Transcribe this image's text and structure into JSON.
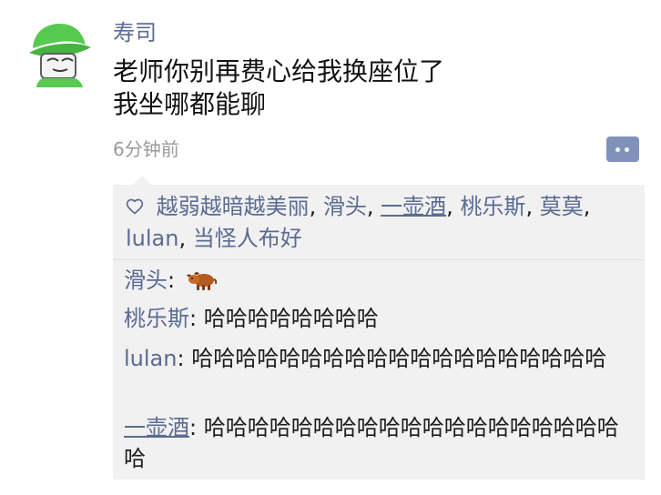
{
  "post": {
    "author": "寿司",
    "text": "老师你别再费心给我换座位了\n我坐哪都能聊",
    "time": "6分钟前"
  },
  "likes": {
    "names": [
      "越弱越暗越美丽",
      "滑头",
      "一壶酒",
      "桃乐斯",
      "莫莫",
      "lulan",
      "当怪人布好"
    ],
    "separator": ", "
  },
  "comments": [
    {
      "author": "滑头",
      "separator": ":",
      "text": "",
      "emoji": "ox"
    },
    {
      "author": "桃乐斯",
      "separator": ":",
      "text": " 哈哈哈哈哈哈哈哈"
    },
    {
      "author": "lulan",
      "separator": ":",
      "text": " 哈哈哈哈哈哈哈哈哈哈哈哈哈哈哈哈哈哈哈"
    },
    {
      "author": "一壶酒",
      "separator": ":",
      "text": " 哈哈哈哈哈哈哈哈哈哈哈哈哈哈哈哈哈哈哈哈"
    }
  ],
  "icons": {
    "like": "heart-icon",
    "more": "more-icon",
    "comment_emoji": "ox-emoji-icon"
  },
  "colors": {
    "name_link": "#5b6b92",
    "comment_background": "#f1f1f1",
    "more_button": "#8092ba",
    "timestamp": "#9a9a9a"
  }
}
